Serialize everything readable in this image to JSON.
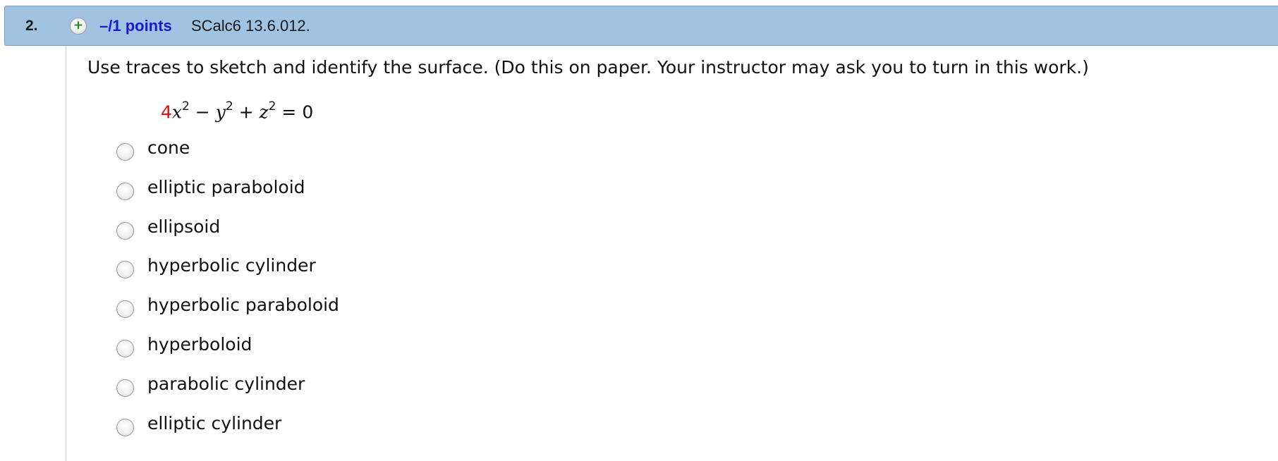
{
  "question": {
    "number": "2.",
    "points": "–/1 points",
    "problem_id": "SCalc6 13.6.012.",
    "prompt": "Use traces to sketch and identify the surface. (Do this on paper. Your instructor may ask you to turn in this work.)",
    "equation": {
      "coefficient": "4",
      "x": "x",
      "x_exp": "2",
      "minus": " − ",
      "y": "y",
      "y_exp": "2",
      "plus": " + ",
      "z": "z",
      "z_exp": "2",
      "equals": " = 0"
    },
    "options": [
      {
        "label": "cone",
        "selected": false
      },
      {
        "label": "elliptic paraboloid",
        "selected": false
      },
      {
        "label": "ellipsoid",
        "selected": false
      },
      {
        "label": "hyperbolic cylinder",
        "selected": false
      },
      {
        "label": "hyperbolic paraboloid",
        "selected": false
      },
      {
        "label": "hyperboloid",
        "selected": false
      },
      {
        "label": "parabolic cylinder",
        "selected": false
      },
      {
        "label": "elliptic cylinder",
        "selected": false
      }
    ]
  },
  "colors": {
    "header_bg": "#9fc3e0",
    "points_link": "#1a1acc",
    "coefficient": "#e01010",
    "plus_icon": "#1c8a1c"
  },
  "icons": {
    "expand": "plus-circle-icon",
    "option": "radio-button"
  }
}
